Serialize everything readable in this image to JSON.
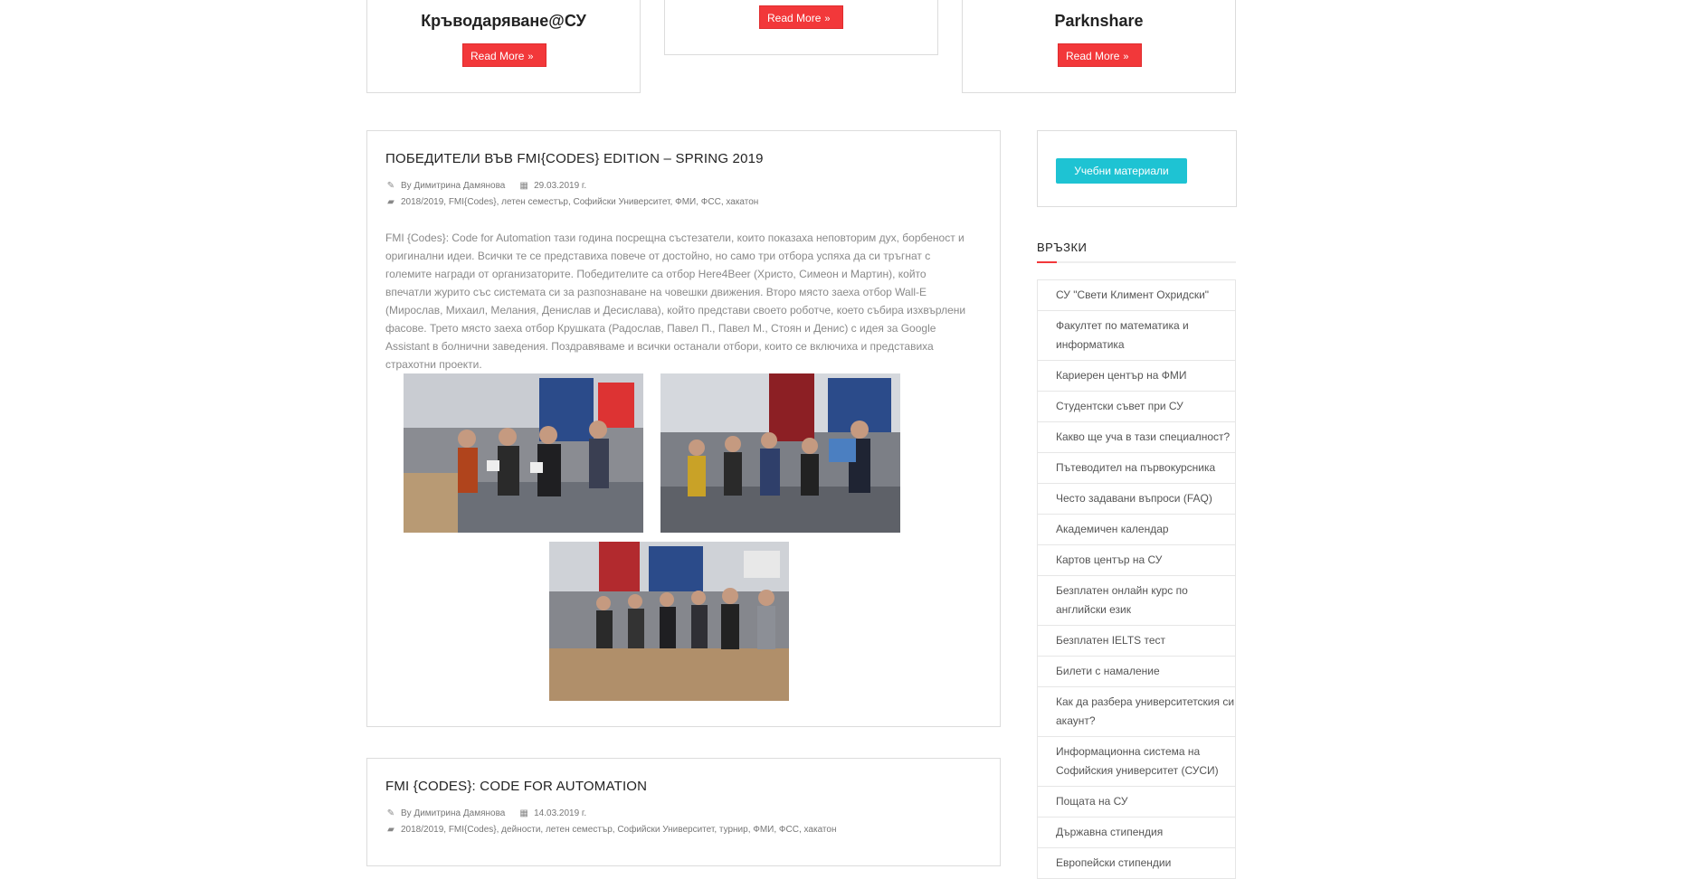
{
  "featured": {
    "card1": {
      "title": "Кръводаряване@СУ",
      "button": "Read More"
    },
    "card2": {
      "button": "Read More"
    },
    "card3": {
      "title": "Parknshare",
      "button": "Read More"
    }
  },
  "posts": [
    {
      "title": "ПОБЕДИТЕЛИ ВЪВ FMI{CODES} EDITION – SPRING 2019",
      "author": "By Димитрина Дамянова",
      "date": "29.03.2019 г.",
      "tags": "2018/2019, FMI{Codes}, летен семестър, Софийски Университет, ФМИ, ФСС, хакатон",
      "excerpt": "FMI {Codes}: Code for Automation тази година посрещна състезатели, които показаха неповторим дух, борбеност и оригинални идеи. Всички те се представиха повече от достойно, но само три отбора успяха да си тръгнат с големите награди от организаторите. Победителите са отбор Here4Beer (Христо, Симеон и Мартин), който впечатли журито със системата си за разпознаване на човешки движения. Второ място заеха отбор Wall-E (Мирослав, Михаил, Мелания, Денислав и Десислава), който представи своето роботче, което събира изхвърлени фасове. Трето място заеха отбор Крушката (Радослав, Павел П., Павел М., Стоян и Денис) с идея за Google Assistant в болнични заведения. Поздравяваме и всички останали отбори, които се включиха и представиха страхотни проекти."
    },
    {
      "title": "FMI {CODES}: CODE FOR AUTOMATION",
      "author": "By Димитрина Дамянова",
      "date": "14.03.2019 г.",
      "tags": "2018/2019, FMI{Codes}, дейности, летен семестър, Софийски Университет, турнир, ФМИ, ФСС, хакатон"
    }
  ],
  "sidebar": {
    "button": "Учебни материали",
    "links_heading": "ВРЪЗКИ",
    "links": [
      "СУ \"Свети Климент Охридски\"",
      "Факултет по математика и информатика",
      "Кариерен център на ФМИ",
      "Студентски съвет при СУ",
      "Какво ще уча в тази специалност?",
      "Пътеводител на първокурсника",
      "Често задавани въпроси (FAQ)",
      "Академичен календар",
      "Картов център на СУ",
      "Безплатен онлайн курс по английски език",
      "Безплатен IELTS тест",
      "Билети с намаление",
      "Как да разбера университетския си акаунт?",
      "Информационна система на Софийския университет (СУСИ)",
      "Пощата на СУ",
      "Държавна стипендия",
      "Европейски стипендии"
    ]
  },
  "icons": {
    "author": "pencil-icon",
    "date": "calendar-icon",
    "tags": "folder-icon",
    "read_more": "double-chevron-right-icon"
  },
  "colors": {
    "accent_red": "#f2383a",
    "accent_cyan": "#1ec3d3"
  }
}
